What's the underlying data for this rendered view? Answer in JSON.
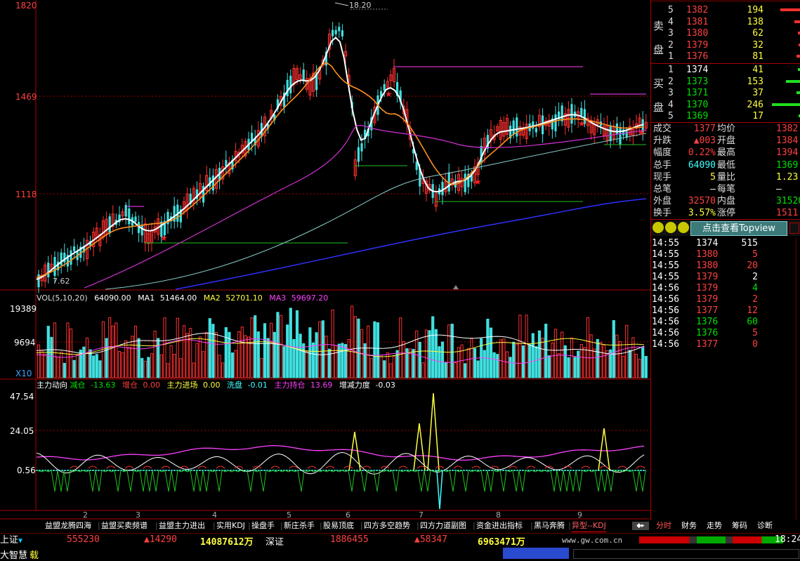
{
  "price_axis": {
    "labels": [
      "1820",
      "1469",
      "1118"
    ]
  },
  "annot": {
    "high": "18.20",
    "low": "7.62"
  },
  "vol_header": {
    "name": "VOL(5,10,20)",
    "v": "64090.00",
    "ma1_label": "MA1",
    "ma1": "51464.00",
    "ma2_label": "MA2",
    "ma2": "52701.10",
    "ma3_label": "MA3",
    "ma3": "59697.20"
  },
  "vol_axis": {
    "labels": [
      "19389",
      "9694"
    ],
    "unit": "X10"
  },
  "ind_header": {
    "name": "主力动向",
    "t1": "减仓",
    "v1": "-13.63",
    "t2": "增仓",
    "v2": "0.00",
    "t3": "主力进场",
    "v3": "0.00",
    "t4": "洗盘",
    "v4": "-0.01",
    "t5": "主力持仓",
    "v5": "13.69",
    "t6": "增减力度",
    "v6": "-0.03"
  },
  "ind_axis": {
    "labels": [
      "47.54",
      "24.05",
      "0.56"
    ]
  },
  "x_ticks": [
    "2",
    "3",
    "4",
    "5",
    "6",
    "7",
    "8",
    "9"
  ],
  "sell": {
    "label1": "卖",
    "label2": "盘",
    "rows": [
      {
        "n": "5",
        "p": "1382",
        "v": "194"
      },
      {
        "n": "4",
        "p": "1381",
        "v": "138"
      },
      {
        "n": "3",
        "p": "1380",
        "v": "62"
      },
      {
        "n": "2",
        "p": "1379",
        "v": "32"
      },
      {
        "n": "1",
        "p": "1376",
        "v": "81"
      }
    ]
  },
  "buy": {
    "label1": "买",
    "label2": "盘",
    "rows": [
      {
        "n": "1",
        "p": "1374",
        "v": "41"
      },
      {
        "n": "2",
        "p": "1373",
        "v": "153"
      },
      {
        "n": "3",
        "p": "1371",
        "v": "37"
      },
      {
        "n": "4",
        "p": "1370",
        "v": "246"
      },
      {
        "n": "5",
        "p": "1369",
        "v": "17"
      }
    ]
  },
  "stats": [
    {
      "k1": "成交",
      "v1": "1377",
      "k2": "均价",
      "v2": "1382"
    },
    {
      "k1": "升跌",
      "v1": "▲003",
      "k2": "开盘",
      "v2": "1384"
    },
    {
      "k1": "幅度",
      "v1": "0.22%",
      "k2": "最高",
      "v2": "1394"
    },
    {
      "k1": "总手",
      "v1": "64090",
      "k2": "最低",
      "v2": "1369"
    },
    {
      "k1": "现手",
      "v1": "5",
      "k2": "量比",
      "v2": "1.23"
    },
    {
      "k1": "总笔",
      "v1": "—",
      "k2": "每笔",
      "v2": "—"
    },
    {
      "k1": "外盘",
      "v1": "32570",
      "k2": "内盘",
      "v2": "31520"
    },
    {
      "k1": "换手",
      "v1": "3.57%",
      "k2": "涨停",
      "v2": "1511"
    }
  ],
  "topview": "点击查看Topview",
  "ticks": [
    {
      "t": "14:55",
      "p": "1374",
      "v": "515"
    },
    {
      "t": "14:55",
      "p": "1380",
      "v": "5"
    },
    {
      "t": "14:55",
      "p": "1380",
      "v": "20"
    },
    {
      "t": "14:55",
      "p": "1379",
      "v": "2"
    },
    {
      "t": "14:56",
      "p": "1379",
      "v": "4"
    },
    {
      "t": "14:56",
      "p": "1379",
      "v": "2"
    },
    {
      "t": "14:56",
      "p": "1377",
      "v": "12"
    },
    {
      "t": "14:56",
      "p": "1376",
      "v": "60"
    },
    {
      "t": "14:56",
      "p": "1376",
      "v": "5"
    },
    {
      "t": "14:56",
      "p": "1377",
      "v": "0"
    }
  ],
  "tabs": [
    "益盟龙腾四海",
    "益盟买卖频谱",
    "益盟主力进出",
    "实用KDJ",
    "操盘手",
    "新庄杀手",
    "股易顶底",
    "四方多空趋势",
    "四方力道副图",
    "资金进出指标",
    "黑马奔腾",
    "异型--KDJ"
  ],
  "rtabs": [
    "分时",
    "财务",
    "走势",
    "筹码",
    "诊断"
  ],
  "status": {
    "sh_label": "上证",
    "sh_val": "555230",
    "sh_chg": "▲14290",
    "sh_amt": "14087612万",
    "sz_label": "深证",
    "sz_val": "1886455",
    "sz_chg": "▲58347",
    "sz_amt": "6963471万",
    "site": "www.gw.com.cn",
    "time": "18:24",
    "brand": "大智慧",
    "brand2": "载"
  }
}
